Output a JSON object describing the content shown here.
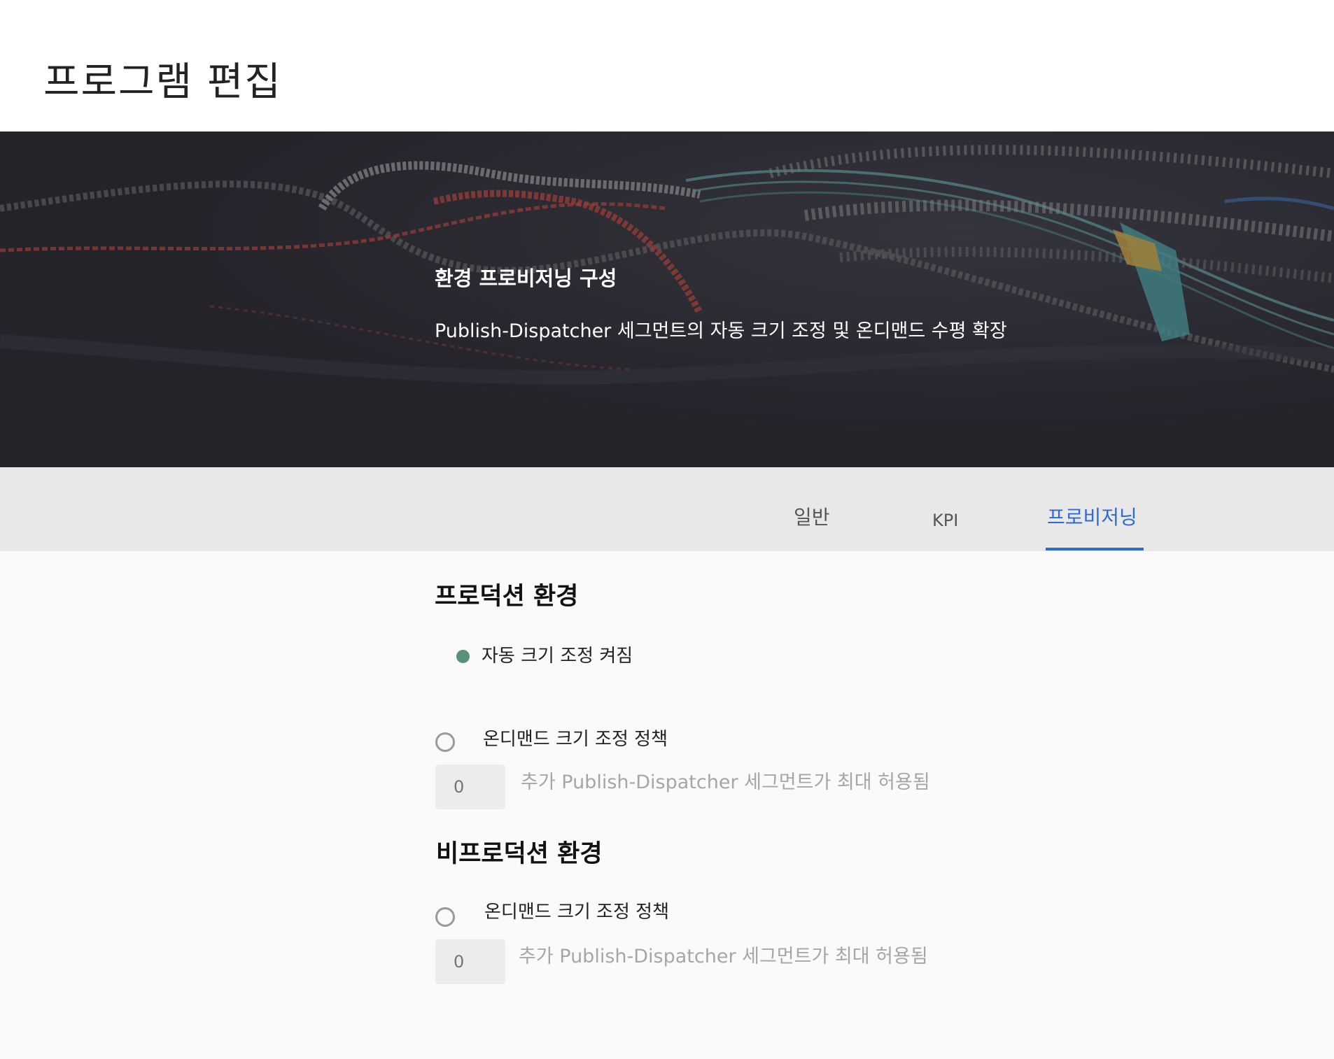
{
  "header": {
    "title": "프로그램 편집"
  },
  "hero": {
    "title": "환경 프로비저닝 구성",
    "subtitle": "Publish-Dispatcher 세그먼트의 자동 크기 조정 및 온디맨드 수평 확장"
  },
  "tabs": [
    {
      "label": "일반",
      "active": false
    },
    {
      "label": "KPI",
      "active": false
    },
    {
      "label": "프로비저닝",
      "active": true
    }
  ],
  "production": {
    "title": "프로덕션 환경",
    "autoscale_status": "자동 크기 조정 켜짐",
    "autoscale_status_color": "#5a9179",
    "on_demand_label": "온디맨드 크기 조정 정책",
    "input_placeholder": "0",
    "help_text": "추가 Publish-Dispatcher 세그먼트가 최대 허용됨"
  },
  "non_production": {
    "title": "비프로덕션 환경",
    "on_demand_label": "온디맨드 크기 조정 정책",
    "input_placeholder": "0",
    "help_text": "추가 Publish-Dispatcher 세그먼트가 최대 허용됨"
  },
  "colors": {
    "accent": "#2d6bd0",
    "hero_background": "#25232a"
  }
}
